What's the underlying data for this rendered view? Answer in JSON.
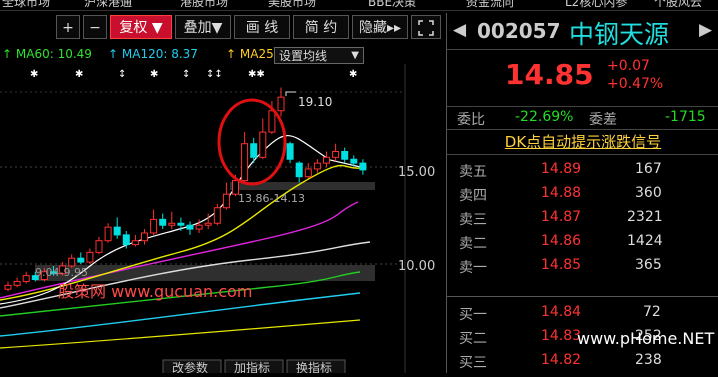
{
  "top_nav": [
    "全球市场",
    "沪深港通",
    "港股市场",
    "美股市场",
    "BBE决策",
    "资金流向",
    "L2核心内参",
    "个股风云"
  ],
  "toolbar": {
    "plus": "+",
    "minus": "−",
    "fq": "复权 ▼",
    "overlay": "叠加▼",
    "draw": "画 线",
    "simple": "简 约",
    "hide": "隐藏▸▸",
    "expand_icon": "expand-icon"
  },
  "ma": {
    "ma60": "MA60: 10.49",
    "ma120": "MA120: 8.37",
    "ma250": "MA25",
    "ma60_color": "#22ee22",
    "ma120_color": "#22ccee",
    "ma250_color": "#ffcc22"
  },
  "ma_settings": "设置均线",
  "chart_data": {
    "type": "candlestick",
    "y_ticks": [
      "15.00",
      "10.00"
    ],
    "annotations": [
      "19.10",
      "13.86-14.13",
      "9.04-9.95"
    ],
    "candles": [
      {
        "o": 8.7,
        "c": 8.9,
        "h": 9.1,
        "l": 8.6
      },
      {
        "o": 8.9,
        "c": 9.1,
        "h": 9.3,
        "l": 8.8
      },
      {
        "o": 9.1,
        "c": 9.4,
        "h": 9.6,
        "l": 9.0
      },
      {
        "o": 9.4,
        "c": 9.2,
        "h": 9.6,
        "l": 9.1
      },
      {
        "o": 9.2,
        "c": 9.6,
        "h": 9.8,
        "l": 9.1
      },
      {
        "o": 9.6,
        "c": 9.5,
        "h": 9.9,
        "l": 9.4
      },
      {
        "o": 9.5,
        "c": 9.9,
        "h": 10.1,
        "l": 9.4
      },
      {
        "o": 9.9,
        "c": 10.3,
        "h": 10.5,
        "l": 9.8
      },
      {
        "o": 10.3,
        "c": 10.1,
        "h": 10.6,
        "l": 10.0
      },
      {
        "o": 10.1,
        "c": 10.6,
        "h": 10.8,
        "l": 10.0
      },
      {
        "o": 10.6,
        "c": 11.2,
        "h": 11.4,
        "l": 10.5
      },
      {
        "o": 11.2,
        "c": 11.9,
        "h": 12.1,
        "l": 11.1
      },
      {
        "o": 11.9,
        "c": 11.5,
        "h": 12.4,
        "l": 11.3
      },
      {
        "o": 11.5,
        "c": 11.0,
        "h": 11.7,
        "l": 10.8
      },
      {
        "o": 11.0,
        "c": 11.2,
        "h": 11.5,
        "l": 10.9
      },
      {
        "o": 11.2,
        "c": 11.6,
        "h": 11.8,
        "l": 11.0
      },
      {
        "o": 11.6,
        "c": 12.3,
        "h": 12.8,
        "l": 11.5
      },
      {
        "o": 12.3,
        "c": 12.0,
        "h": 12.6,
        "l": 11.8
      },
      {
        "o": 12.0,
        "c": 12.1,
        "h": 12.7,
        "l": 11.8
      },
      {
        "o": 12.1,
        "c": 12.0,
        "h": 12.4,
        "l": 11.7
      },
      {
        "o": 12.0,
        "c": 11.8,
        "h": 12.2,
        "l": 11.5
      },
      {
        "o": 11.8,
        "c": 12.0,
        "h": 12.3,
        "l": 11.6
      },
      {
        "o": 12.0,
        "c": 12.1,
        "h": 12.6,
        "l": 11.8
      },
      {
        "o": 12.1,
        "c": 12.9,
        "h": 13.1,
        "l": 12.0
      },
      {
        "o": 12.9,
        "c": 13.6,
        "h": 14.2,
        "l": 12.8
      },
      {
        "o": 13.6,
        "c": 14.3,
        "h": 14.6,
        "l": 13.5
      },
      {
        "o": 14.3,
        "c": 16.2,
        "h": 16.8,
        "l": 14.2
      },
      {
        "o": 16.2,
        "c": 15.5,
        "h": 16.5,
        "l": 15.2
      },
      {
        "o": 15.5,
        "c": 16.8,
        "h": 17.5,
        "l": 15.4
      },
      {
        "o": 16.8,
        "c": 17.9,
        "h": 18.4,
        "l": 16.7
      },
      {
        "o": 17.9,
        "c": 18.6,
        "h": 19.1,
        "l": 17.6
      },
      {
        "o": 16.2,
        "c": 15.4,
        "h": 16.3,
        "l": 15.2
      },
      {
        "o": 15.2,
        "c": 14.5,
        "h": 15.3,
        "l": 14.2
      },
      {
        "o": 14.5,
        "c": 14.9,
        "h": 15.2,
        "l": 14.4
      },
      {
        "o": 14.9,
        "c": 15.2,
        "h": 15.4,
        "l": 14.7
      },
      {
        "o": 15.2,
        "c": 15.5,
        "h": 15.8,
        "l": 15.0
      },
      {
        "o": 15.5,
        "c": 15.8,
        "h": 16.2,
        "l": 15.3
      },
      {
        "o": 15.8,
        "c": 15.4,
        "h": 16.0,
        "l": 15.2
      },
      {
        "o": 15.4,
        "c": 15.2,
        "h": 15.6,
        "l": 15.0
      },
      {
        "o": 15.2,
        "c": 14.85,
        "h": 15.4,
        "l": 14.6
      }
    ]
  },
  "stock": {
    "code": "002057",
    "name": "中钢天源",
    "price": "14.85",
    "change": "+0.07",
    "change_pct": "+0.47%",
    "weibi_label": "委比",
    "weibi": "-22.69%",
    "weicha_label": "委差",
    "weicha": "-1715",
    "dk_signal": "DK点自动提示涨跌信号"
  },
  "order_book": {
    "asks": [
      {
        "label": "卖五",
        "price": "14.89",
        "vol": "167"
      },
      {
        "label": "卖四",
        "price": "14.88",
        "vol": "360"
      },
      {
        "label": "卖三",
        "price": "14.87",
        "vol": "2321"
      },
      {
        "label": "卖二",
        "price": "14.86",
        "vol": "1424"
      },
      {
        "label": "卖一",
        "price": "14.85",
        "vol": "365"
      }
    ],
    "bids": [
      {
        "label": "买一",
        "price": "14.84",
        "vol": "72"
      },
      {
        "label": "买二",
        "price": "14.83",
        "vol": "252"
      },
      {
        "label": "买三",
        "price": "14.82",
        "vol": "238"
      }
    ]
  },
  "bottom_tabs": [
    "改参数",
    "加指标",
    "换指标"
  ],
  "watermark": {
    "site_left": "股策网 www.gucuan.com",
    "site_right": "www.pHome.NET"
  },
  "colors": {
    "up": "#ff3030",
    "down": "#00e0e0",
    "accent_red": "#e01010",
    "positive": "#ff3232",
    "negative": "#22dd22",
    "signal": "#ffd23d"
  }
}
